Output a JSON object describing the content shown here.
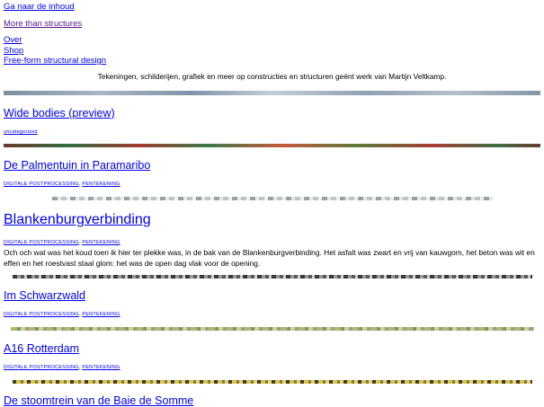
{
  "skip_link": "Ga naar de inhoud",
  "site_title": "More than structures",
  "nav": [
    "Over",
    "Shop",
    "Free-form structural design"
  ],
  "site_description": "Tekeningen, schilderijen, grafiek en meer op constructies en structuren geënt werk van Martijn Veltkamp.",
  "posts": [
    {
      "title": "Wide bodies (preview)",
      "categories": [
        "uncategorized"
      ]
    },
    {
      "title": "De Palmentuin in Paramaribo",
      "categories": [
        "DIGITALE POSTPROCESSING",
        "PENTEKENING"
      ]
    },
    {
      "title": "Blankenburgverbinding",
      "categories": [
        "DIGITALE POSTPROCESSING",
        "PENTEKENING"
      ],
      "excerpt": "Och och wat was het koud toen ik hier ter plekke was, in de bak van de Blankenburgverbinding. Het asfalt was zwart en vrij van kauwgom, het beton was wit en effen en het roestvast staal glom: het was de open dag vlak voor de opening."
    },
    {
      "title": "Im Schwarzwald",
      "categories": [
        "DIGITALE POSTPROCESSING",
        "PENTEKENING"
      ]
    },
    {
      "title": "A16 Rotterdam",
      "categories": [
        "DIGITALE POSTPROCESSING",
        "PENTEKENING"
      ]
    },
    {
      "title": "De stoomtrein van de Baie de Somme",
      "categories": []
    }
  ],
  "category_separator": ", "
}
